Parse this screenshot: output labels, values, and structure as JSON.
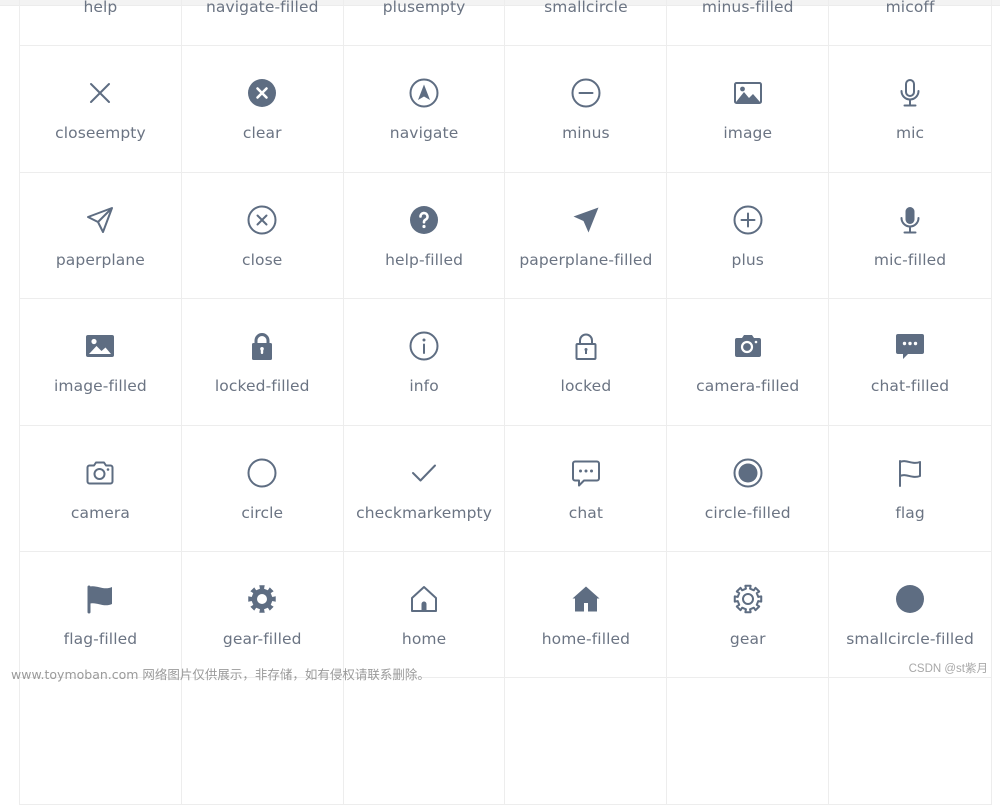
{
  "icon_color": "#5e6d82",
  "grid": {
    "cells": [
      {
        "label": "help",
        "icon": "help-icon"
      },
      {
        "label": "navigate-filled",
        "icon": "navigate-filled-icon"
      },
      {
        "label": "plusempty",
        "icon": "plus-empty-icon"
      },
      {
        "label": "smallcircle",
        "icon": "small-circle-icon"
      },
      {
        "label": "minus-filled",
        "icon": "minus-filled-icon"
      },
      {
        "label": "micoff",
        "icon": "mic-off-icon"
      },
      {
        "label": "closeempty",
        "icon": "close-empty-icon"
      },
      {
        "label": "clear",
        "icon": "clear-icon"
      },
      {
        "label": "navigate",
        "icon": "navigate-icon"
      },
      {
        "label": "minus",
        "icon": "minus-icon"
      },
      {
        "label": "image",
        "icon": "image-icon"
      },
      {
        "label": "mic",
        "icon": "mic-icon"
      },
      {
        "label": "paperplane",
        "icon": "paperplane-icon"
      },
      {
        "label": "close",
        "icon": "close-icon"
      },
      {
        "label": "help-filled",
        "icon": "help-filled-icon"
      },
      {
        "label": "paperplane-filled",
        "icon": "paperplane-filled-icon"
      },
      {
        "label": "plus",
        "icon": "plus-icon"
      },
      {
        "label": "mic-filled",
        "icon": "mic-filled-icon"
      },
      {
        "label": "image-filled",
        "icon": "image-filled-icon"
      },
      {
        "label": "locked-filled",
        "icon": "locked-filled-icon"
      },
      {
        "label": "info",
        "icon": "info-icon"
      },
      {
        "label": "locked",
        "icon": "locked-icon"
      },
      {
        "label": "camera-filled",
        "icon": "camera-filled-icon"
      },
      {
        "label": "chat-filled",
        "icon": "chat-filled-icon"
      },
      {
        "label": "camera",
        "icon": "camera-icon"
      },
      {
        "label": "circle",
        "icon": "circle-icon"
      },
      {
        "label": "checkmarkempty",
        "icon": "checkmark-empty-icon"
      },
      {
        "label": "chat",
        "icon": "chat-icon"
      },
      {
        "label": "circle-filled",
        "icon": "circle-filled-icon"
      },
      {
        "label": "flag",
        "icon": "flag-icon"
      },
      {
        "label": "flag-filled",
        "icon": "flag-filled-icon"
      },
      {
        "label": "gear-filled",
        "icon": "gear-filled-icon"
      },
      {
        "label": "home",
        "icon": "home-icon"
      },
      {
        "label": "home-filled",
        "icon": "home-filled-icon"
      },
      {
        "label": "gear",
        "icon": "gear-icon"
      },
      {
        "label": "smallcircle-filled",
        "icon": "small-circle-filled-icon"
      }
    ]
  },
  "watermarks": {
    "left": "www.toymoban.com 网络图片仅供展示，非存储，如有侵权请联系删除。",
    "right": "CSDN @st紫月"
  }
}
